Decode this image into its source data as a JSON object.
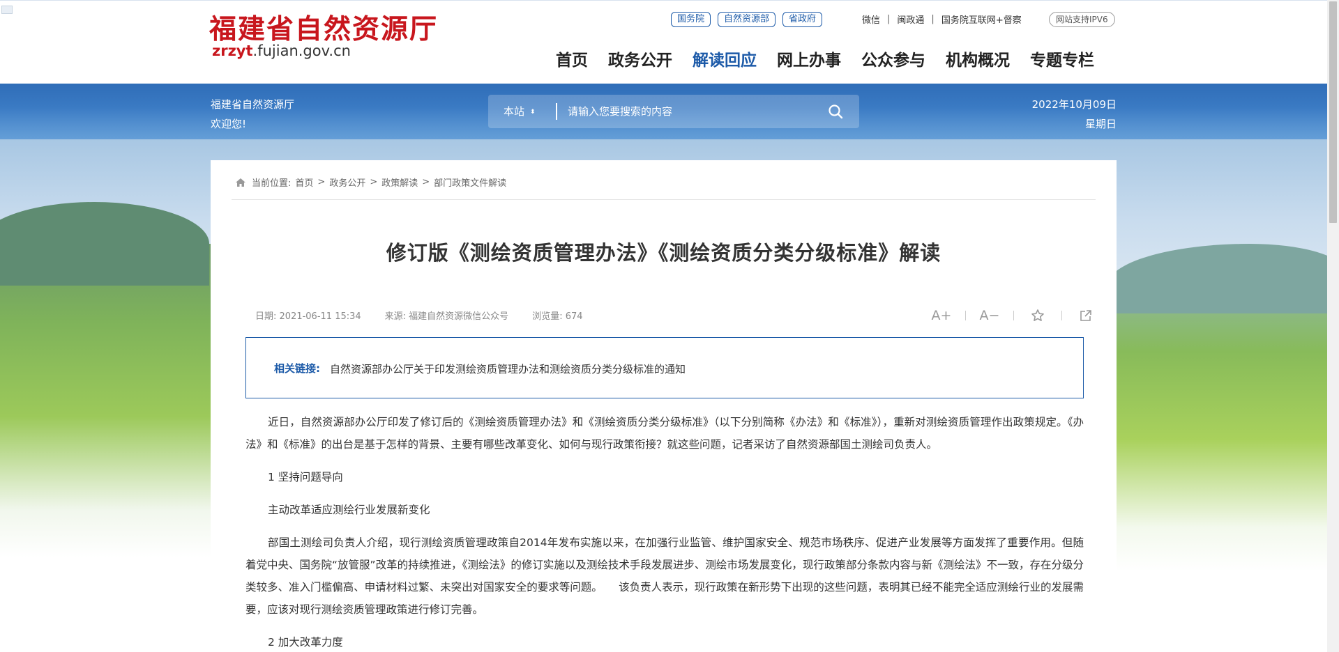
{
  "header": {
    "logo_cn": "福建省自然资源厅",
    "logo_en_prefix": "zrzyt",
    "logo_en_suffix": ".fujian.gov.cn",
    "top_buttons": [
      "国务院",
      "自然资源部",
      "省政府"
    ],
    "top_links": [
      "微信",
      "闽政通",
      "国务院互联网+督察"
    ],
    "ipv6": "网站支持IPV6",
    "nav": [
      "首页",
      "政务公开",
      "解读回应",
      "网上办事",
      "公众参与",
      "机构概况",
      "专题专栏"
    ],
    "active_nav": "解读回应"
  },
  "banner": {
    "welcome_line1": "福建省自然资源厅",
    "welcome_line2": "欢迎您!",
    "search_scope": "本站",
    "search_placeholder": "请输入您要搜索的内容",
    "date": "2022年10月09日",
    "weekday": "星期日"
  },
  "breadcrumb": {
    "label": "当前位置:",
    "items": [
      "首页",
      "政务公开",
      "政策解读",
      "部门政策文件解读"
    ]
  },
  "article": {
    "title": "修订版《测绘资质管理办法》《测绘资质分类分级标准》解读",
    "date": "日期: 2021-06-11 15:34",
    "source": "来源: 福建自然资源微信公众号",
    "views": "浏览量: 674",
    "tools": [
      "A+",
      "A−"
    ],
    "related_label": "相关链接:",
    "related_link": "自然资源部办公厅关于印发测绘资质管理办法和测绘资质分类分级标准的通知",
    "paragraphs": [
      "近日，自然资源部办公厅印发了修订后的《测绘资质管理办法》和《测绘资质分类分级标准》（以下分别简称《办法》和《标准》），重新对测绘资质管理作出政策规定。《办法》和《标准》的出台是基于怎样的背景、主要有哪些改革变化、如何与现行政策衔接？就这些问题，记者采访了自然资源部国土测绘司负责人。",
      "1 坚持问题导向",
      "主动改革适应测绘行业发展新变化",
      "部国土测绘司负责人介绍，现行测绘资质管理政策自2014年发布实施以来，在加强行业监管、维护国家安全、规范市场秩序、促进产业发展等方面发挥了重要作用。但随着党中央、国务院“放管服”改革的持续推进，《测绘法》的修订实施以及测绘技术手段发展进步、测绘市场发展变化，现行政策部分条款内容与新《测绘法》不一致，存在分级分类较多、准入门槛偏高、申请材料过繁、未突出对国家安全的要求等问题。　　该负责人表示，现行政策在新形势下出现的这些问题，表明其已经不能完全适应测绘行业的发展需要，应该对现行测绘资质管理政策进行修订完善。",
      "2 加大改革力度"
    ]
  },
  "colors": {
    "brand_red": "#c8161d",
    "brand_blue": "#1c5aa8"
  }
}
